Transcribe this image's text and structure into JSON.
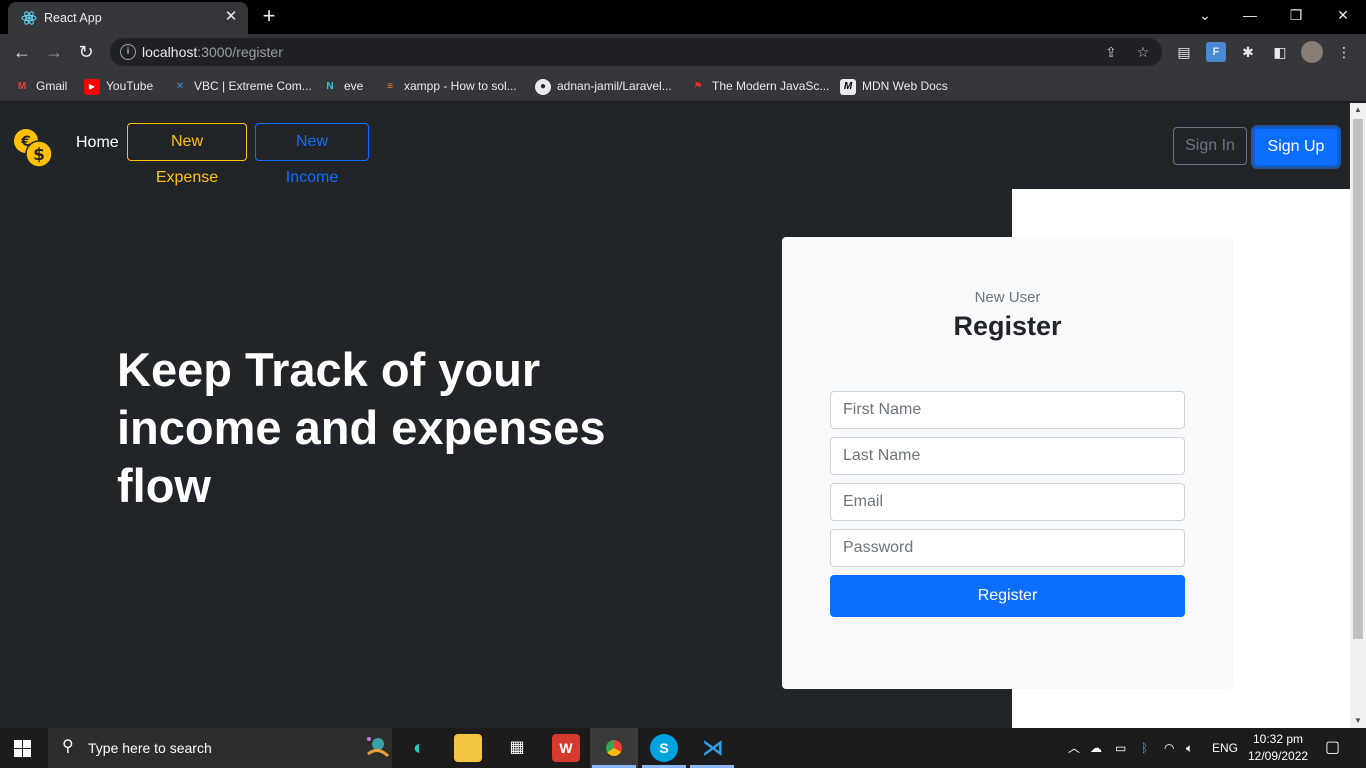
{
  "browser": {
    "tab_title": "React App",
    "url_host": "localhost",
    "url_rest": ":3000/register",
    "bookmarks": [
      {
        "label": "Gmail",
        "icon": "gmail-icon"
      },
      {
        "label": "YouTube",
        "icon": "youtube-icon"
      },
      {
        "label": "VBC | Extreme Com...",
        "icon": "vbc-icon"
      },
      {
        "label": "eve",
        "icon": "eve-icon"
      },
      {
        "label": "xampp - How to sol...",
        "icon": "stackoverflow-icon"
      },
      {
        "label": "adnan-jamil/Laravel...",
        "icon": "github-icon"
      },
      {
        "label": "The Modern JavaSc...",
        "icon": "javascript-info-icon"
      },
      {
        "label": "MDN Web Docs",
        "icon": "mdn-icon"
      }
    ]
  },
  "navbar": {
    "home": "Home",
    "new_expense": "New Expense",
    "new_income": "New Income",
    "sign_in": "Sign In",
    "sign_up": "Sign Up"
  },
  "hero": {
    "headline": "Keep Track of your income and expenses flow"
  },
  "register_card": {
    "subtitle": "New User",
    "title": "Register",
    "first_name_placeholder": "First Name",
    "last_name_placeholder": "Last Name",
    "email_placeholder": "Email",
    "password_placeholder": "Password",
    "submit": "Register"
  },
  "taskbar": {
    "search_placeholder": "Type here to search",
    "language": "ENG",
    "time": "10:32 pm",
    "date": "12/09/2022"
  },
  "colors": {
    "page_bg": "#212529",
    "primary": "#0d6efd",
    "warning": "#ffc107",
    "secondary": "#6c757d",
    "card_bg": "#f8f9fa"
  }
}
